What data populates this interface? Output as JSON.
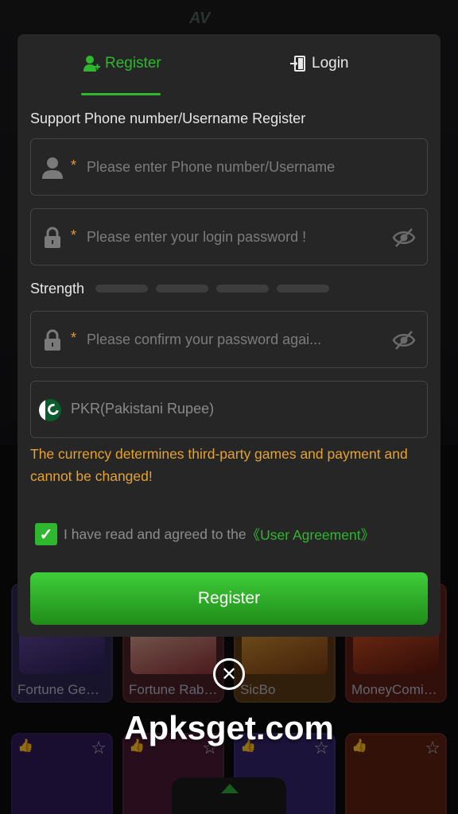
{
  "background": {
    "logo": "AV",
    "games": [
      {
        "name": "Fortune Ge…",
        "color": "#3b2d5e"
      },
      {
        "name": "Fortune Rab…",
        "color": "#7a2b2f"
      },
      {
        "name": "SicBo",
        "color": "#8a5a1f"
      },
      {
        "name": "MoneyComi…",
        "color": "#7a2a1a"
      }
    ],
    "games_row2": [
      {
        "color": "#3a1e6e"
      },
      {
        "color": "#5a1d3a"
      },
      {
        "color": "#3e2b7a"
      },
      {
        "color": "#6e2512"
      }
    ]
  },
  "tabs": {
    "register": "Register",
    "login": "Login",
    "register_icon": "user-plus-icon",
    "login_icon": "login-door-icon"
  },
  "form": {
    "subtitle": "Support Phone number/Username Register",
    "username_placeholder": "Please enter Phone number/Username",
    "password_placeholder": "Please enter your login password !",
    "confirm_placeholder": "Please confirm your password agai...",
    "required_mark": "*",
    "strength_label": "Strength",
    "currency": "PKR(Pakistani Rupee)",
    "currency_warning": "The currency determines third-party games and payment and cannot be changed!",
    "agree_text": "I have read and agreed to the",
    "agree_link": "《User Agreement》",
    "agreed": true,
    "submit_label": "Register"
  },
  "colors": {
    "accent": "#2fb72f",
    "warning": "#e5a22f",
    "modal_bg": "#262626"
  },
  "watermark": "Apksget.com"
}
